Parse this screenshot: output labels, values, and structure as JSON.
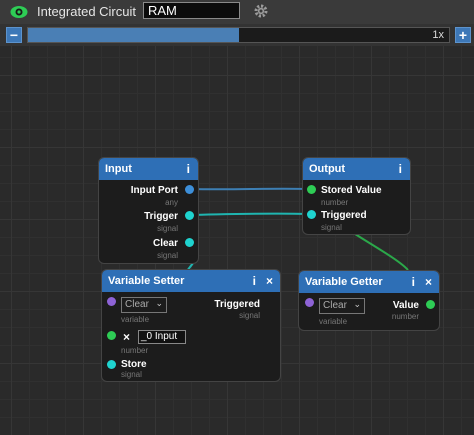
{
  "header": {
    "title": "Integrated Circuit",
    "name_value": "RAM"
  },
  "zoom": {
    "minus": "−",
    "plus": "+",
    "level_label": "1x",
    "fill_fraction": 0.5
  },
  "colors": {
    "header_blue": "#2e6fb6",
    "port_blue": "#3d8fd9",
    "port_teal": "#1fd3cf",
    "port_green": "#2ecc55",
    "port_purple": "#8e63d6"
  },
  "nodes": {
    "input": {
      "title": "Input",
      "info": "i",
      "input_port": {
        "label": "Input Port",
        "type": "any"
      },
      "trigger": {
        "label": "Trigger",
        "type": "signal"
      },
      "clear": {
        "label": "Clear",
        "type": "signal"
      }
    },
    "output": {
      "title": "Output",
      "info": "i",
      "stored_value": {
        "label": "Stored Value",
        "type": "number"
      },
      "triggered": {
        "label": "Triggered",
        "type": "signal"
      }
    },
    "setter": {
      "title": "Variable Setter",
      "info": "i",
      "close": "×",
      "variable": {
        "value": "Clear",
        "type": "variable"
      },
      "triggered": {
        "label": "Triggered",
        "type": "signal"
      },
      "number": {
        "x": "×",
        "input_text": "_0 Input",
        "type": "number"
      },
      "store": {
        "label": "Store",
        "type": "signal"
      }
    },
    "getter": {
      "title": "Variable Getter",
      "info": "i",
      "close": "×",
      "variable": {
        "value": "Clear",
        "type": "variable"
      },
      "value": {
        "label": "Value",
        "type": "number"
      }
    }
  }
}
